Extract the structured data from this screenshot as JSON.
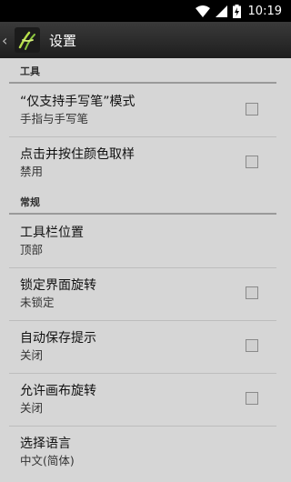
{
  "status_bar": {
    "time": "10:19",
    "icons": [
      "wifi-icon",
      "signal-icon",
      "battery-charging-icon"
    ]
  },
  "action_bar": {
    "title": "设置",
    "up_icon": "chevron-left-icon",
    "app_icon": "app-logo-icon"
  },
  "sections": [
    {
      "header": "工具",
      "items": [
        {
          "title": "“仅支持手写笔”模式",
          "summary": "手指与手写笔",
          "checkbox": true,
          "checked": false
        },
        {
          "title": "点击并按住颜色取样",
          "summary": "禁用",
          "checkbox": true,
          "checked": false
        }
      ]
    },
    {
      "header": "常规",
      "items": [
        {
          "title": "工具栏位置",
          "summary": "顶部",
          "checkbox": false
        },
        {
          "title": "锁定界面旋转",
          "summary": "未锁定",
          "checkbox": true,
          "checked": false
        },
        {
          "title": "自动保存提示",
          "summary": "关闭",
          "checkbox": true,
          "checked": false
        },
        {
          "title": "允许画布旋转",
          "summary": "关闭",
          "checkbox": true,
          "checked": false
        },
        {
          "title": "选择语言",
          "summary": "中文(简体)",
          "checkbox": false
        }
      ]
    }
  ]
}
